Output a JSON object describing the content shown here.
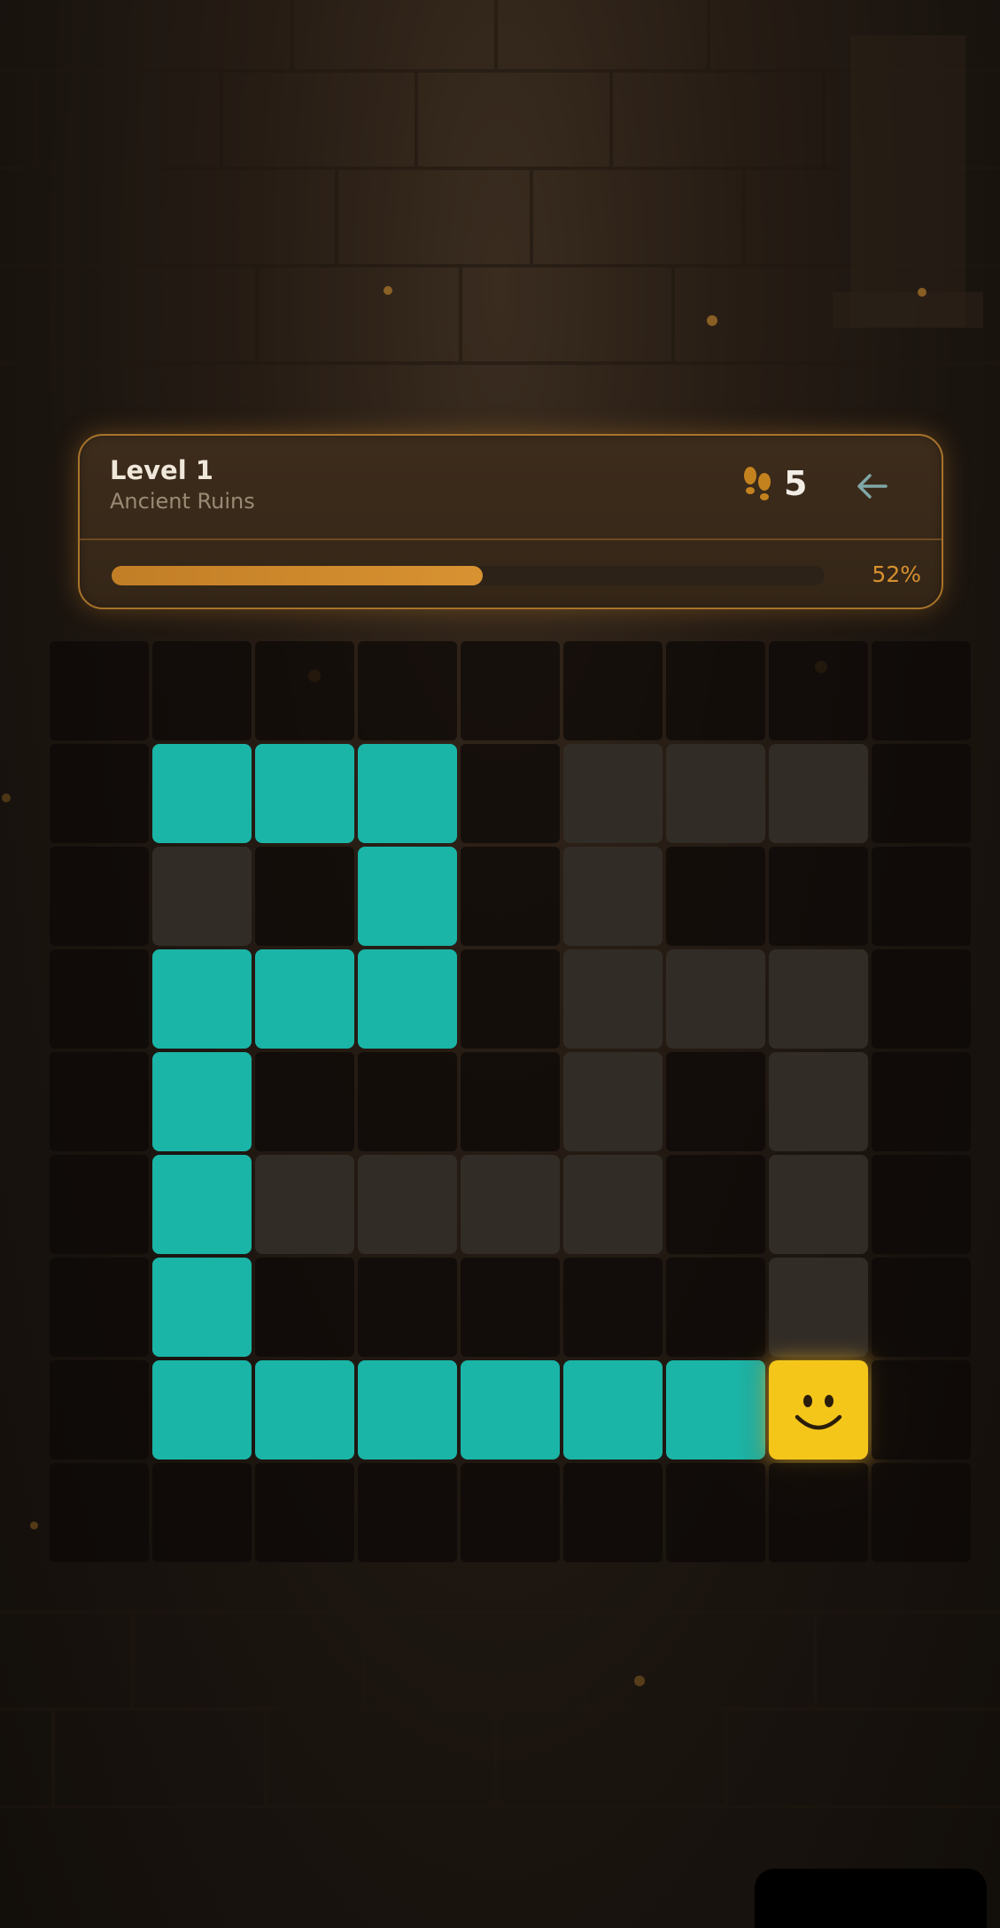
{
  "hud": {
    "level_title": "Level 1",
    "level_subtitle": "Ancient Ruins",
    "moves_icon": "footprints-icon",
    "moves_count": "5",
    "back_icon": "arrow-left-icon",
    "progress_percent": 52,
    "progress_label": "52%"
  },
  "colors": {
    "accent": "#d7902f",
    "path": "#1ab5a7",
    "wall": "#322c27",
    "player": "#f5c61a"
  },
  "board": {
    "columns": 9,
    "rows": 9,
    "legend": {
      "0": "empty",
      "1": "wall",
      "2": "path",
      "3": "player"
    },
    "grid": [
      [
        0,
        0,
        0,
        0,
        0,
        0,
        0,
        0,
        0
      ],
      [
        0,
        2,
        2,
        2,
        0,
        1,
        1,
        1,
        0
      ],
      [
        0,
        1,
        0,
        2,
        0,
        1,
        0,
        0,
        0
      ],
      [
        0,
        2,
        2,
        2,
        0,
        1,
        1,
        1,
        0
      ],
      [
        0,
        2,
        0,
        0,
        0,
        1,
        0,
        1,
        0
      ],
      [
        0,
        2,
        1,
        1,
        1,
        1,
        0,
        1,
        0
      ],
      [
        0,
        2,
        0,
        0,
        0,
        0,
        0,
        1,
        0
      ],
      [
        0,
        2,
        2,
        2,
        2,
        2,
        2,
        3,
        0
      ],
      [
        0,
        0,
        0,
        0,
        0,
        0,
        0,
        0,
        0
      ]
    ],
    "player_icon": "smiley-face-icon"
  }
}
